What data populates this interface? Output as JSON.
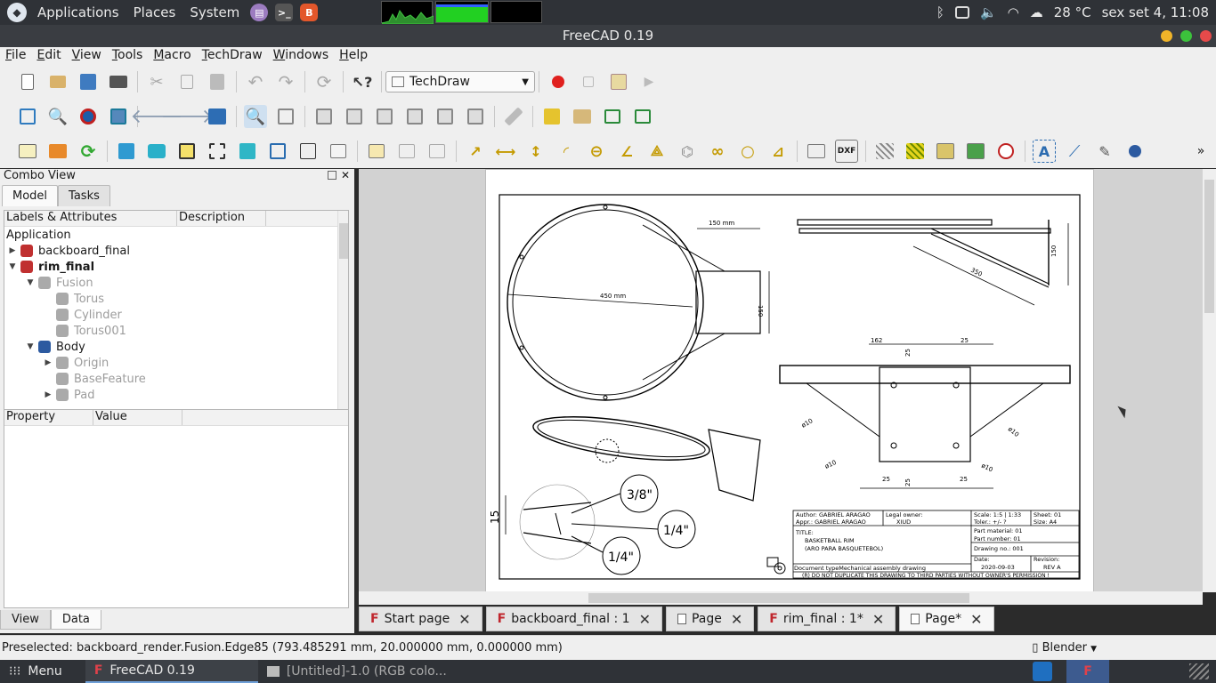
{
  "top_panel": {
    "menus": [
      "Applications",
      "Places",
      "System"
    ],
    "temperature": "28 °C",
    "clock": "sex set  4, 11:08"
  },
  "window": {
    "title": "FreeCAD 0.19"
  },
  "menubar": [
    "File",
    "Edit",
    "View",
    "Tools",
    "Macro",
    "TechDraw",
    "Windows",
    "Help"
  ],
  "toolbar": {
    "workbench": "TechDraw"
  },
  "combo": {
    "title": "Combo View",
    "tabs": [
      "Model",
      "Tasks"
    ],
    "tree_headers": [
      "Labels & Attributes",
      "Description"
    ],
    "tree": [
      {
        "label": "Application",
        "level": 0,
        "arrow": "",
        "dim": false,
        "bold": false
      },
      {
        "label": "backboard_final",
        "level": 1,
        "arrow": "▶",
        "dim": false,
        "bold": false
      },
      {
        "label": "rim_final",
        "level": 1,
        "arrow": "▼",
        "dim": false,
        "bold": true
      },
      {
        "label": "Fusion",
        "level": 2,
        "arrow": "▼",
        "dim": true,
        "bold": false
      },
      {
        "label": "Torus",
        "level": 3,
        "arrow": "",
        "dim": true,
        "bold": false
      },
      {
        "label": "Cylinder",
        "level": 3,
        "arrow": "",
        "dim": true,
        "bold": false
      },
      {
        "label": "Torus001",
        "level": 3,
        "arrow": "",
        "dim": true,
        "bold": false
      },
      {
        "label": "Body",
        "level": 2,
        "arrow": "▼",
        "dim": false,
        "bold": false
      },
      {
        "label": "Origin",
        "level": 3,
        "arrow": "▶",
        "dim": true,
        "bold": false
      },
      {
        "label": "BaseFeature",
        "level": 3,
        "arrow": "",
        "dim": true,
        "bold": false
      },
      {
        "label": "Pad",
        "level": 3,
        "arrow": "▶",
        "dim": true,
        "bold": false
      }
    ],
    "prop_headers": [
      "Property",
      "Value"
    ],
    "bottom_tabs": [
      "View",
      "Data"
    ]
  },
  "drawing": {
    "dims": {
      "d450": "450 mm",
      "d150": "150 mm",
      "d150v": "150",
      "d350": "350",
      "d150s": "150",
      "d162": "162",
      "d25a": "25",
      "d25b": "25",
      "d25c": "25",
      "d25d": "25",
      "d25e": "25",
      "phi10a": "ø10",
      "phi10b": "ø10",
      "phi10c": "ø10",
      "phi10d": "ø10",
      "d15": "15",
      "c38": "3/8\"",
      "c14a": "1/4\"",
      "c14b": "1/4\""
    },
    "titleblock": {
      "author": "Author:   GABRIEL ARAGAO",
      "appr": "Appr.:    GABRIEL ARAGAO",
      "owner_label": "Legal owner:",
      "owner": "XIUD",
      "scale": "Scale:    1:5 | 1:33",
      "toler": "Toler.:    +/-  ?",
      "sheet": "Sheet:    01",
      "size": "Size:      A4",
      "material": "Part material:   01",
      "number": "Part number:   01",
      "drawing_no": "Drawing no.:    001",
      "title_label": "TITLE:",
      "title1": "BASKETBALL RIM",
      "title2": "(ARO PARA BASQUETEBOL)",
      "date_label": "Date:",
      "date": "2020-09-03",
      "rev_label": "Revision:",
      "rev": "REV A",
      "doctype": "Document typeMechanical assembly drawing",
      "notice": "(R) DO NOT DUPLICATE THIS DRAWING TO THIRD PARTIES WITHOUT OWNER'S PERMISSION !"
    }
  },
  "mdi_tabs": [
    {
      "label": "Start page",
      "active": false
    },
    {
      "label": "backboard_final : 1",
      "active": false
    },
    {
      "label": "Page",
      "active": false
    },
    {
      "label": "rim_final : 1*",
      "active": false
    },
    {
      "label": "Page*",
      "active": true
    }
  ],
  "status": {
    "text": "Preselected: backboard_render.Fusion.Edge85 (793.485291 mm, 20.000000 mm, 0.000000 mm)",
    "nav_style": "Blender"
  },
  "taskbar": {
    "menu": "Menu",
    "tasks": [
      "FreeCAD 0.19",
      "[Untitled]-1.0 (RGB colo..."
    ]
  }
}
